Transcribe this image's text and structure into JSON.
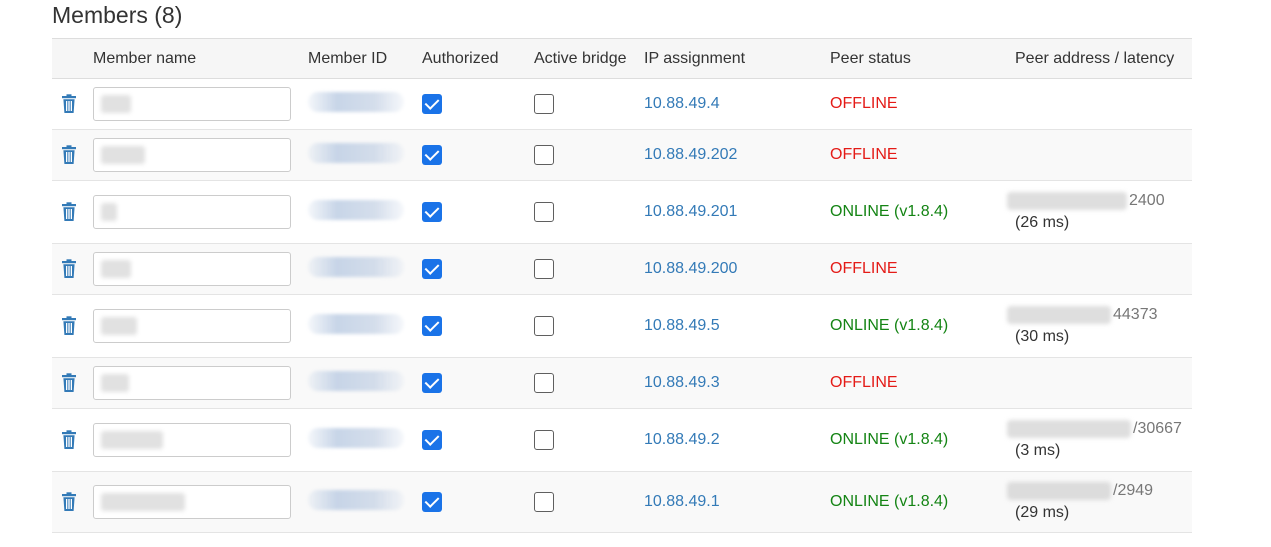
{
  "title": "Members (8)",
  "columns": [
    "",
    "Member name",
    "Member ID",
    "Authorized",
    "Active bridge",
    "IP assignment",
    "Peer status",
    "Peer address / latency"
  ],
  "rows": [
    {
      "ip": "10.88.49.4",
      "status": "OFFLINE",
      "online": false,
      "authorized": true,
      "bridge": false,
      "peer_addr_tail": "",
      "latency": ""
    },
    {
      "ip": "10.88.49.202",
      "status": "OFFLINE",
      "online": false,
      "authorized": true,
      "bridge": false,
      "peer_addr_tail": "",
      "latency": ""
    },
    {
      "ip": "10.88.49.201",
      "status": "ONLINE (v1.8.4)",
      "online": true,
      "authorized": true,
      "bridge": false,
      "peer_addr_tail": "2400",
      "latency": "(26 ms)"
    },
    {
      "ip": "10.88.49.200",
      "status": "OFFLINE",
      "online": false,
      "authorized": true,
      "bridge": false,
      "peer_addr_tail": "",
      "latency": ""
    },
    {
      "ip": "10.88.49.5",
      "status": "ONLINE (v1.8.4)",
      "online": true,
      "authorized": true,
      "bridge": false,
      "peer_addr_tail": "44373",
      "latency": "(30 ms)"
    },
    {
      "ip": "10.88.49.3",
      "status": "OFFLINE",
      "online": false,
      "authorized": true,
      "bridge": false,
      "peer_addr_tail": "",
      "latency": ""
    },
    {
      "ip": "10.88.49.2",
      "status": "ONLINE (v1.8.4)",
      "online": true,
      "authorized": true,
      "bridge": false,
      "peer_addr_tail": "/30667",
      "latency": "(3 ms)"
    },
    {
      "ip": "10.88.49.1",
      "status": "ONLINE (v1.8.4)",
      "online": true,
      "authorized": true,
      "bridge": false,
      "peer_addr_tail": "/2949",
      "latency": "(29 ms)"
    }
  ],
  "icons": {
    "delete": "trash-icon",
    "authorized": "checkbox-checked",
    "bridge": "checkbox-unchecked"
  },
  "colors": {
    "link": "#337ab7",
    "offline": "#e41b17",
    "online": "#148414",
    "checkbox": "#1a73e8"
  }
}
